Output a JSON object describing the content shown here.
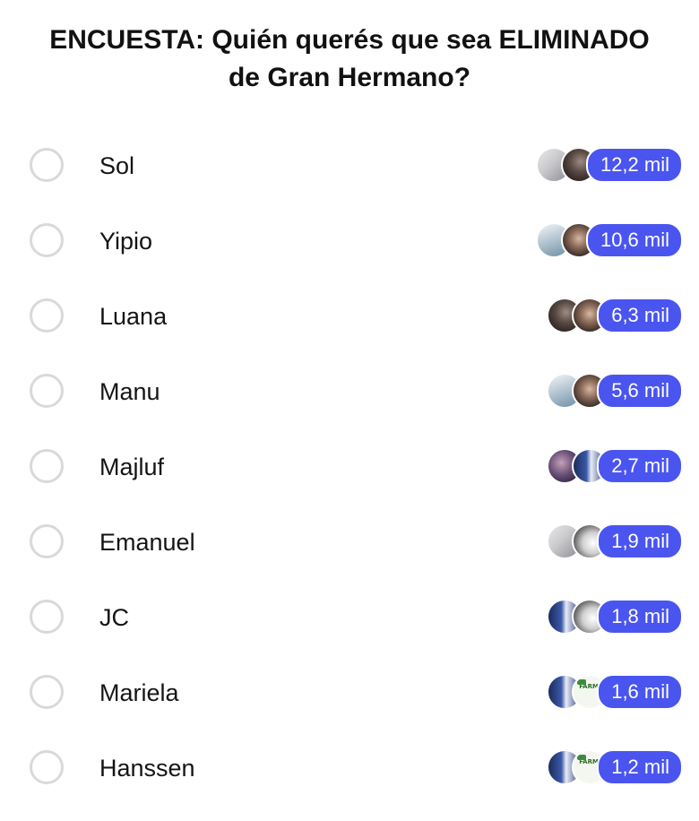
{
  "poll": {
    "title": "ENCUESTA: Quién querés que sea ELIMINADO de Gran Hermano?",
    "accent_color": "#4a55f0",
    "options": [
      {
        "label": "Sol",
        "votes": "12,2 mil",
        "avatars": [
          "av-light",
          "av-dark"
        ]
      },
      {
        "label": "Yipio",
        "votes": "10,6 mil",
        "avatars": [
          "av-sky",
          "av-face"
        ]
      },
      {
        "label": "Luana",
        "votes": "6,3 mil",
        "avatars": [
          "av-dark",
          "av-face"
        ]
      },
      {
        "label": "Manu",
        "votes": "5,6 mil",
        "avatars": [
          "av-sky",
          "av-face"
        ]
      },
      {
        "label": "Majluf",
        "votes": "2,7 mil",
        "avatars": [
          "av-purple",
          "av-blue"
        ]
      },
      {
        "label": "Emanuel",
        "votes": "1,9 mil",
        "avatars": [
          "av-light",
          "av-bw"
        ]
      },
      {
        "label": "JC",
        "votes": "1,8 mil",
        "avatars": [
          "av-blue",
          "av-bw"
        ]
      },
      {
        "label": "Mariela",
        "votes": "1,6 mil",
        "avatars": [
          "av-blue",
          "av-farma"
        ]
      },
      {
        "label": "Hanssen",
        "votes": "1,2 mil",
        "avatars": [
          "av-blue",
          "av-farma"
        ]
      }
    ]
  }
}
